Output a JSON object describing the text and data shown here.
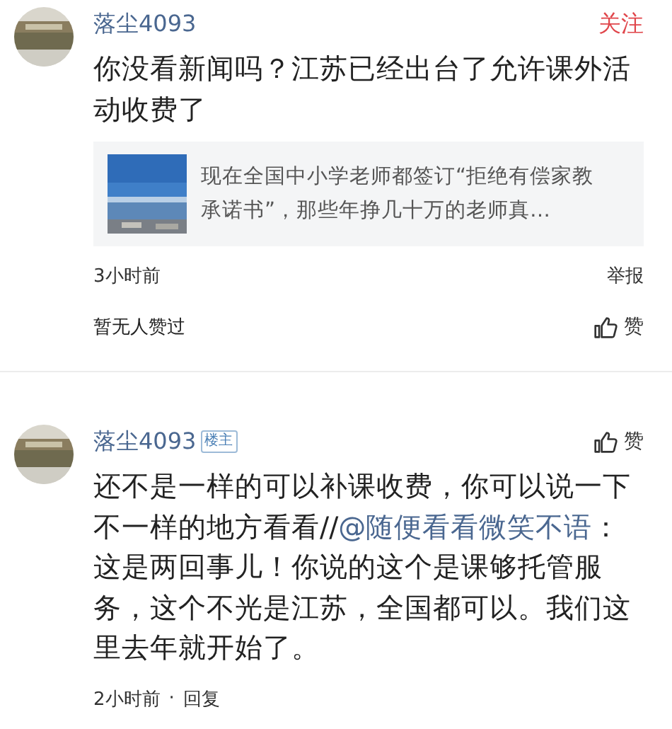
{
  "comments": [
    {
      "author": "落尘4093",
      "follow": "关注",
      "body": [
        {
          "kind": "plain",
          "text": "你没看新闻吗？江苏已经出台了允许课外活动收费了"
        }
      ],
      "link_card": {
        "kind": "picture",
        "text": "现在全国中小学老师都签订“拒绝有偿家教承诺书”，那些年挣几十万的老师真…"
      },
      "time": "3小时前",
      "report": "举报",
      "likes_text": "暂无人赞过",
      "like_label": "赞"
    },
    {
      "author": "落尘4093",
      "badge": "楼主",
      "body": [
        {
          "kind": "plain",
          "text": "还不是一样的可以补课收费，你可以说一下不一样的地方看看//"
        },
        {
          "kind": "mention",
          "text": "@随便看看微笑不语"
        },
        {
          "kind": "plain",
          "text": "：这是两回事儿！你说的这个是课够托管服务，这个不光是江苏，全国都可以。我们这里去年就开始了。"
        }
      ],
      "time": "2小时前",
      "separator": "·",
      "like_label": "赞",
      "reply": "回复"
    }
  ]
}
